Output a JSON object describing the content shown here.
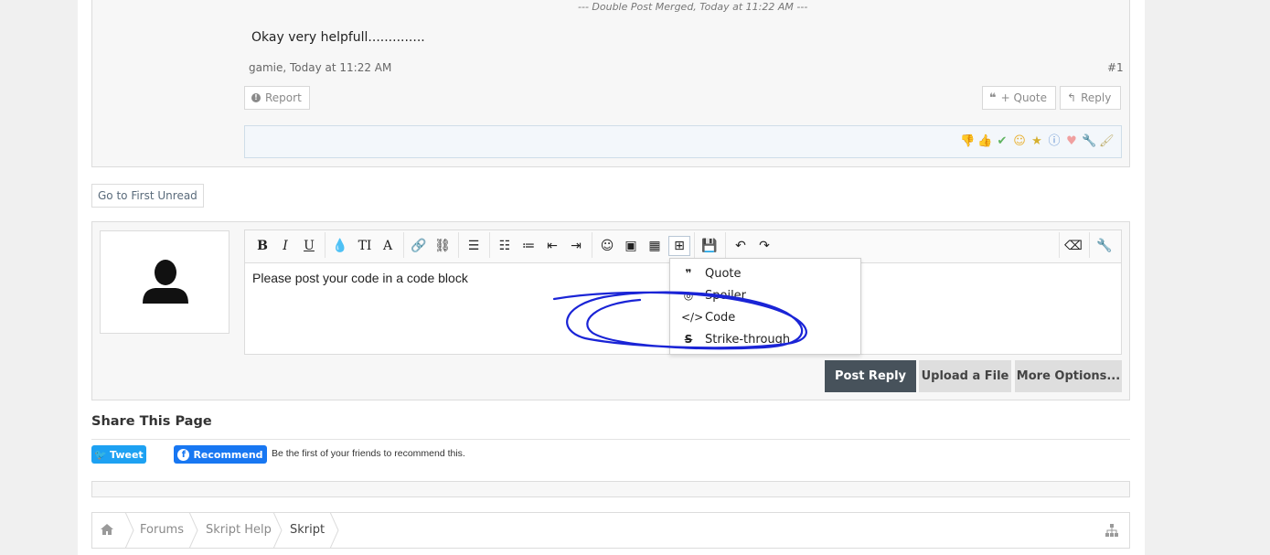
{
  "post": {
    "merge_note_prefix": "--- Double Post Merged,",
    "merge_note_time": "Today at 11:22 AM",
    "merge_note_suffix": "---",
    "message": "Okay very helpfull..............",
    "author_meta": "gamie, Today at 11:22 AM",
    "post_number": "#1",
    "report_label": "Report",
    "quote_label": "+ Quote",
    "reply_label": "Reply",
    "reaction_icons": [
      "thumbs-down-icon",
      "thumbs-up-icon",
      "check-icon",
      "smile-icon",
      "star-icon",
      "info-icon",
      "heart-icon",
      "wrench-icon",
      "brush-icon"
    ]
  },
  "go_first_unread": "Go to First Unread",
  "editor": {
    "content": "Please post your code in a code block",
    "toolbar": {
      "bold": "B",
      "italic": "I",
      "underline": "U",
      "size": "TI",
      "font": "A"
    },
    "insert_menu": [
      {
        "label": "Quote",
        "icon": "quote-icon"
      },
      {
        "label": "Spoiler",
        "icon": "eye-slash-icon"
      },
      {
        "label": "Code",
        "icon": "code-icon"
      },
      {
        "label": "Strike-through",
        "icon": "strikethrough-icon"
      }
    ],
    "post_reply": "Post Reply",
    "upload_file": "Upload a File",
    "more_options": "More Options..."
  },
  "share": {
    "title": "Share This Page",
    "tweet": "Tweet",
    "recommend": "Recommend",
    "fb_text": "Be the first of your friends to recommend this."
  },
  "breadcrumb": [
    "Forums",
    "Skript Help",
    "Skript"
  ],
  "colors": {
    "primary_button": "#47525b",
    "twitter": "#1da1f2",
    "facebook": "#1877f2",
    "ink": "#1a24d6"
  }
}
